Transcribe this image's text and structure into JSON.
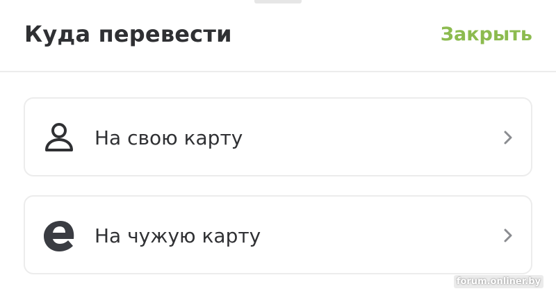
{
  "sheet": {
    "title": "Куда перевести",
    "close_label": "Закрыть"
  },
  "options": [
    {
      "label": "На свою карту",
      "icon": "person-icon"
    },
    {
      "label": "На чужую карту",
      "icon": "e-logo-icon"
    }
  ],
  "watermark": "forum.onliner.by",
  "colors": {
    "accent": "#8cbb4f",
    "text": "#2f3033",
    "border": "#ececec",
    "chevron": "#8a8c90"
  }
}
